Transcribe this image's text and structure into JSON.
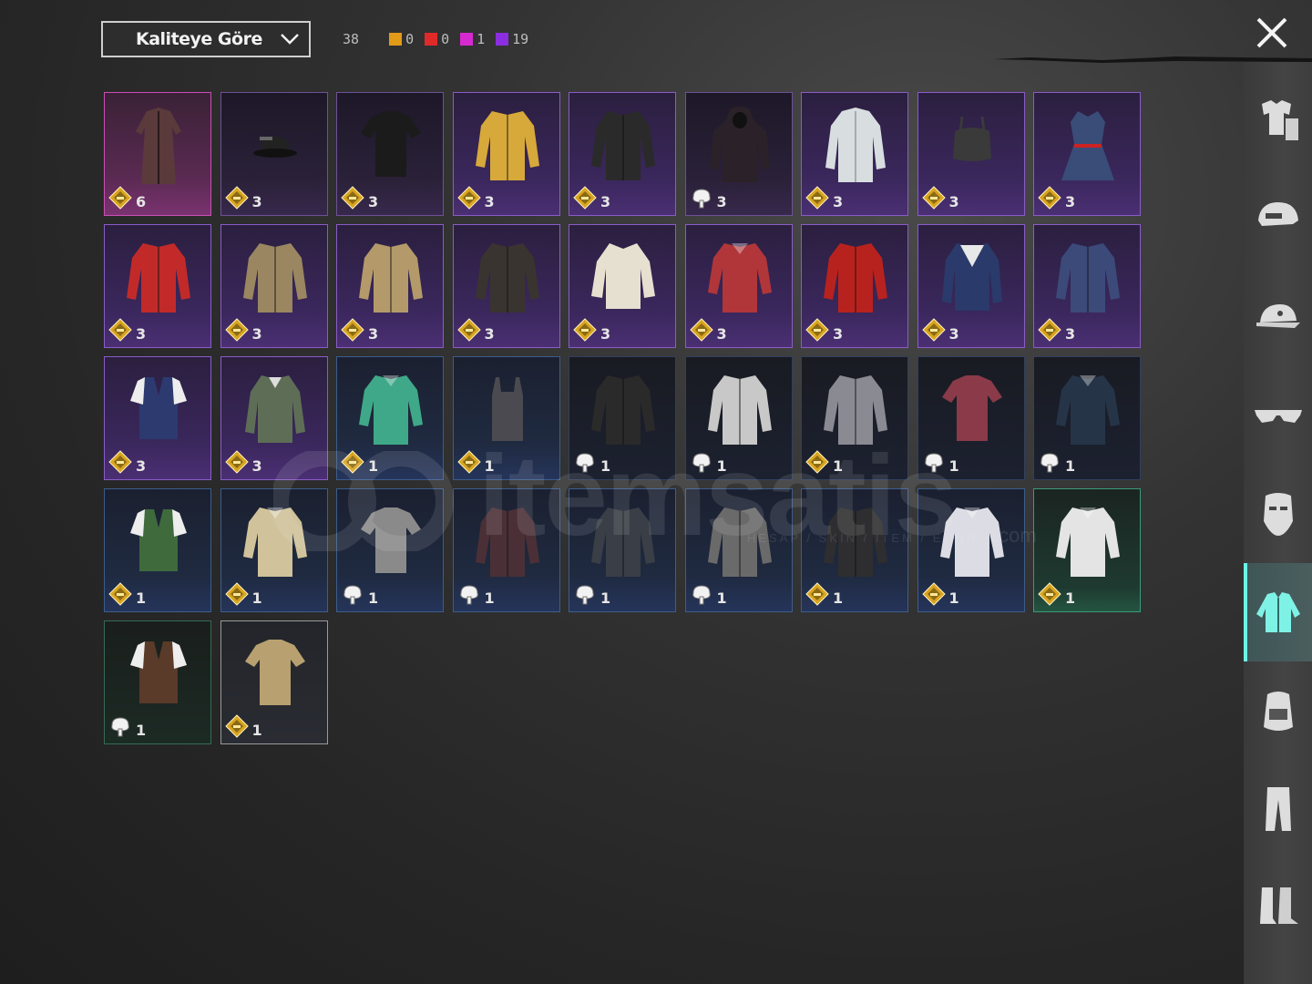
{
  "sort": {
    "label": "Kaliteye Göre"
  },
  "counts": {
    "total": "38",
    "items": [
      {
        "color": "#e39a18",
        "value": "0"
      },
      {
        "color": "#e02a2a",
        "value": "0"
      },
      {
        "color": "#d62ad0",
        "value": "1"
      },
      {
        "color": "#8a2ee0",
        "value": "19"
      }
    ]
  },
  "colors": {
    "accent": "#6cf2e6",
    "badge": "#d9a520",
    "panel": "#2a2a2a"
  },
  "sidebar": {
    "tabs": [
      {
        "name": "outfit-icon",
        "active": false
      },
      {
        "name": "helmet-icon",
        "active": false
      },
      {
        "name": "cap-icon",
        "active": false
      },
      {
        "name": "glasses-icon",
        "active": false
      },
      {
        "name": "mask-icon",
        "active": false
      },
      {
        "name": "jacket-icon",
        "active": true
      },
      {
        "name": "backpack-icon",
        "active": false
      },
      {
        "name": "pants-icon",
        "active": false
      },
      {
        "name": "boots-icon",
        "active": false
      }
    ]
  },
  "items": [
    {
      "tier": "magenta",
      "badge": "coin",
      "qty": "6",
      "garment": "long-coat",
      "color": "#5a3a3a"
    },
    {
      "tier": "purple-dark",
      "badge": "coin",
      "qty": "3",
      "garment": "hat",
      "color": "#222"
    },
    {
      "tier": "purple-dark",
      "badge": "coin",
      "qty": "3",
      "garment": "tshirt",
      "color": "#1b1b1b"
    },
    {
      "tier": "purple",
      "badge": "coin",
      "qty": "3",
      "garment": "jacket",
      "color": "#d7a93a"
    },
    {
      "tier": "purple",
      "badge": "coin",
      "qty": "3",
      "garment": "jacket",
      "color": "#2a2a2a"
    },
    {
      "tier": "purple-dark",
      "badge": "crate",
      "qty": "3",
      "garment": "hoodie",
      "color": "#2a2228"
    },
    {
      "tier": "purple",
      "badge": "coin",
      "qty": "3",
      "garment": "labcoat",
      "color": "#d8dde0"
    },
    {
      "tier": "purple",
      "badge": "coin",
      "qty": "3",
      "garment": "top",
      "color": "#3a3a3a"
    },
    {
      "tier": "purple",
      "badge": "coin",
      "qty": "3",
      "garment": "dress",
      "color": "#3a4c78"
    },
    {
      "tier": "purple",
      "badge": "coin",
      "qty": "3",
      "garment": "jacket",
      "color": "#c22a2a"
    },
    {
      "tier": "purple",
      "badge": "coin",
      "qty": "3",
      "garment": "jacket",
      "color": "#9a8660"
    },
    {
      "tier": "purple",
      "badge": "coin",
      "qty": "3",
      "garment": "jacket",
      "color": "#b49a6a"
    },
    {
      "tier": "purple",
      "badge": "coin",
      "qty": "3",
      "garment": "jacket",
      "color": "#3a3430"
    },
    {
      "tier": "purple",
      "badge": "coin",
      "qty": "3",
      "garment": "blouse",
      "color": "#e6e0d0"
    },
    {
      "tier": "purple",
      "badge": "coin",
      "qty": "3",
      "garment": "shirt",
      "color": "#b0363a"
    },
    {
      "tier": "purple",
      "badge": "coin",
      "qty": "3",
      "garment": "jacket",
      "color": "#b8221e"
    },
    {
      "tier": "purple",
      "badge": "coin",
      "qty": "3",
      "garment": "sailor",
      "color": "#2a3a6a"
    },
    {
      "tier": "purple",
      "badge": "coin",
      "qty": "3",
      "garment": "jacket",
      "color": "#3c4a7a"
    },
    {
      "tier": "purple",
      "badge": "coin",
      "qty": "3",
      "garment": "vest",
      "color": "#2c3a70"
    },
    {
      "tier": "purple",
      "badge": "coin",
      "qty": "3",
      "garment": "sweater",
      "color": "#5e6e56"
    },
    {
      "tier": "blue",
      "badge": "coin",
      "qty": "1",
      "garment": "shirt",
      "color": "#3fa888"
    },
    {
      "tier": "blue",
      "badge": "coin",
      "qty": "1",
      "garment": "tanktop",
      "color": "#4a4a50"
    },
    {
      "tier": "blue-dark",
      "badge": "crate",
      "qty": "1",
      "garment": "jacket",
      "color": "#2a2a2a"
    },
    {
      "tier": "blue-dark",
      "badge": "crate",
      "qty": "1",
      "garment": "jacket",
      "color": "#c8c8c8"
    },
    {
      "tier": "blue-dark",
      "badge": "coin",
      "qty": "1",
      "garment": "jacket",
      "color": "#8a8a92"
    },
    {
      "tier": "blue-dark",
      "badge": "crate",
      "qty": "1",
      "garment": "tshirt",
      "color": "#8a3a48"
    },
    {
      "tier": "blue-dark",
      "badge": "crate",
      "qty": "1",
      "garment": "shirt",
      "color": "#263448"
    },
    {
      "tier": "blue",
      "badge": "coin",
      "qty": "1",
      "garment": "vest",
      "color": "#3e6a3c"
    },
    {
      "tier": "blue",
      "badge": "coin",
      "qty": "1",
      "garment": "shirt",
      "color": "#d0c29a"
    },
    {
      "tier": "blue",
      "badge": "crate",
      "qty": "1",
      "garment": "tshirt",
      "color": "#8a8a8a"
    },
    {
      "tier": "blue",
      "badge": "crate",
      "qty": "1",
      "garment": "jacket",
      "color": "#4a3036"
    },
    {
      "tier": "blue",
      "badge": "crate",
      "qty": "1",
      "garment": "jacket",
      "color": "#3a3e46"
    },
    {
      "tier": "blue",
      "badge": "crate",
      "qty": "1",
      "garment": "jacket",
      "color": "#6a6a6a"
    },
    {
      "tier": "blue",
      "badge": "coin",
      "qty": "1",
      "garment": "jacket",
      "color": "#2e2e30"
    },
    {
      "tier": "blue",
      "badge": "coin",
      "qty": "1",
      "garment": "shirt",
      "color": "#dcdce4"
    },
    {
      "tier": "green",
      "badge": "coin",
      "qty": "1",
      "garment": "shirt",
      "color": "#e4e4e4"
    },
    {
      "tier": "green-dark",
      "badge": "crate",
      "qty": "1",
      "garment": "vest",
      "color": "#5a3a28"
    },
    {
      "tier": "gray",
      "badge": "coin",
      "qty": "1",
      "garment": "tshirt",
      "color": "#b8a070"
    }
  ],
  "watermark": {
    "text": "itemsatis",
    "sub": "HESAP / SKIN / ITEM / E-PIN",
    "com": ".com"
  }
}
